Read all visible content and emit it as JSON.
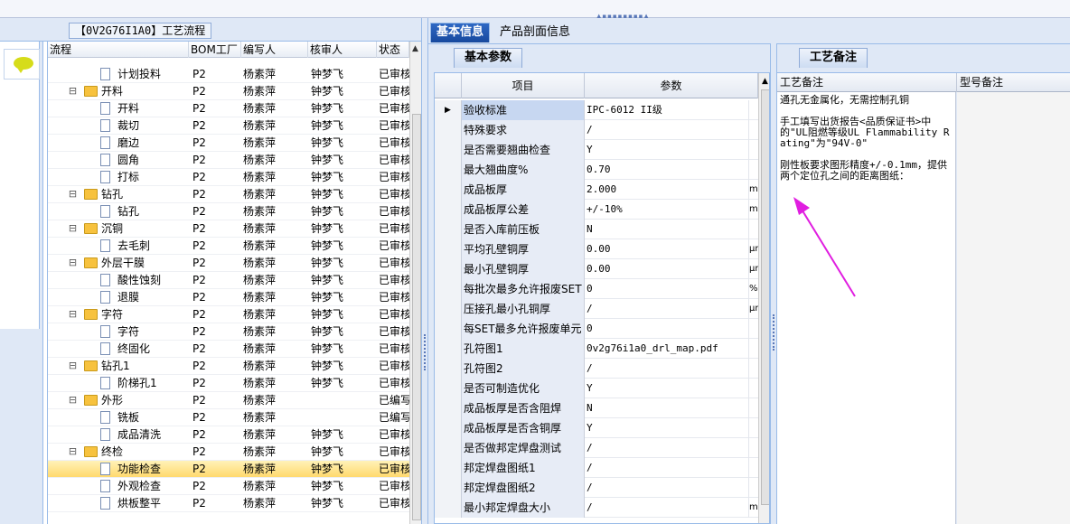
{
  "process_tab_title": "【0V2G76I1A0】工艺流程",
  "tree": {
    "columns": [
      "流程",
      "BOM工厂",
      "编写人",
      "核审人",
      "状态"
    ],
    "rows": [
      {
        "level": 1,
        "type": "doc",
        "name": "计划投料",
        "bom": "P2",
        "writer": "杨素萍",
        "reviewer": "钟梦飞",
        "status": "已审核"
      },
      {
        "level": 0,
        "type": "folder",
        "name": "开料",
        "bom": "P2",
        "writer": "杨素萍",
        "reviewer": "钟梦飞",
        "status": "已审核"
      },
      {
        "level": 1,
        "type": "doc",
        "name": "开料",
        "bom": "P2",
        "writer": "杨素萍",
        "reviewer": "钟梦飞",
        "status": "已审核"
      },
      {
        "level": 1,
        "type": "doc",
        "name": "裁切",
        "bom": "P2",
        "writer": "杨素萍",
        "reviewer": "钟梦飞",
        "status": "已审核"
      },
      {
        "level": 1,
        "type": "doc",
        "name": "磨边",
        "bom": "P2",
        "writer": "杨素萍",
        "reviewer": "钟梦飞",
        "status": "已审核"
      },
      {
        "level": 1,
        "type": "doc",
        "name": "圆角",
        "bom": "P2",
        "writer": "杨素萍",
        "reviewer": "钟梦飞",
        "status": "已审核"
      },
      {
        "level": 1,
        "type": "doc",
        "name": "打标",
        "bom": "P2",
        "writer": "杨素萍",
        "reviewer": "钟梦飞",
        "status": "已审核"
      },
      {
        "level": 0,
        "type": "folder",
        "name": "钻孔",
        "bom": "P2",
        "writer": "杨素萍",
        "reviewer": "钟梦飞",
        "status": "已审核"
      },
      {
        "level": 1,
        "type": "doc",
        "name": "钻孔",
        "bom": "P2",
        "writer": "杨素萍",
        "reviewer": "钟梦飞",
        "status": "已审核"
      },
      {
        "level": 0,
        "type": "folder",
        "name": "沉铜",
        "bom": "P2",
        "writer": "杨素萍",
        "reviewer": "钟梦飞",
        "status": "已审核"
      },
      {
        "level": 1,
        "type": "doc",
        "name": "去毛刺",
        "bom": "P2",
        "writer": "杨素萍",
        "reviewer": "钟梦飞",
        "status": "已审核"
      },
      {
        "level": 0,
        "type": "folder",
        "name": "外层干膜",
        "bom": "P2",
        "writer": "杨素萍",
        "reviewer": "钟梦飞",
        "status": "已审核"
      },
      {
        "level": 1,
        "type": "doc",
        "name": "酸性蚀刻",
        "bom": "P2",
        "writer": "杨素萍",
        "reviewer": "钟梦飞",
        "status": "已审核"
      },
      {
        "level": 1,
        "type": "doc",
        "name": "退膜",
        "bom": "P2",
        "writer": "杨素萍",
        "reviewer": "钟梦飞",
        "status": "已审核"
      },
      {
        "level": 0,
        "type": "folder",
        "name": "字符",
        "bom": "P2",
        "writer": "杨素萍",
        "reviewer": "钟梦飞",
        "status": "已审核"
      },
      {
        "level": 1,
        "type": "doc",
        "name": "字符",
        "bom": "P2",
        "writer": "杨素萍",
        "reviewer": "钟梦飞",
        "status": "已审核"
      },
      {
        "level": 1,
        "type": "doc",
        "name": "终固化",
        "bom": "P2",
        "writer": "杨素萍",
        "reviewer": "钟梦飞",
        "status": "已审核"
      },
      {
        "level": 0,
        "type": "folder",
        "name": "钻孔1",
        "bom": "P2",
        "writer": "杨素萍",
        "reviewer": "钟梦飞",
        "status": "已审核"
      },
      {
        "level": 1,
        "type": "doc",
        "name": "阶梯孔1",
        "bom": "P2",
        "writer": "杨素萍",
        "reviewer": "钟梦飞",
        "status": "已审核"
      },
      {
        "level": 0,
        "type": "folder",
        "name": "外形",
        "bom": "P2",
        "writer": "杨素萍",
        "reviewer": "",
        "status": "已编写"
      },
      {
        "level": 1,
        "type": "doc",
        "name": "铣板",
        "bom": "P2",
        "writer": "杨素萍",
        "reviewer": "",
        "status": "已编写"
      },
      {
        "level": 1,
        "type": "doc",
        "name": "成品清洗",
        "bom": "P2",
        "writer": "杨素萍",
        "reviewer": "钟梦飞",
        "status": "已审核"
      },
      {
        "level": 0,
        "type": "folder",
        "name": "终检",
        "bom": "P2",
        "writer": "杨素萍",
        "reviewer": "钟梦飞",
        "status": "已审核"
      },
      {
        "level": 1,
        "type": "doc",
        "name": "功能检查",
        "bom": "P2",
        "writer": "杨素萍",
        "reviewer": "钟梦飞",
        "status": "已审核",
        "selected": true
      },
      {
        "level": 1,
        "type": "doc",
        "name": "外观检查",
        "bom": "P2",
        "writer": "杨素萍",
        "reviewer": "钟梦飞",
        "status": "已审核"
      },
      {
        "level": 1,
        "type": "doc",
        "name": "烘板整平",
        "bom": "P2",
        "writer": "杨素萍",
        "reviewer": "钟梦飞",
        "status": "已审核"
      }
    ]
  },
  "main_tabs": [
    "基本信息",
    "产品剖面信息"
  ],
  "sub_tab": "基本参数",
  "params": {
    "columns": [
      "项目",
      "参数"
    ],
    "rows": [
      {
        "key": "验收标准",
        "value": "IPC-6012 II级",
        "unit": "",
        "current": true
      },
      {
        "key": "特殊要求",
        "value": "/",
        "unit": ""
      },
      {
        "key": "是否需要翘曲检查",
        "value": "Y",
        "unit": ""
      },
      {
        "key": "最大翘曲度%",
        "value": "0.70",
        "unit": ""
      },
      {
        "key": "成品板厚",
        "value": "2.000",
        "unit": "mm"
      },
      {
        "key": "成品板厚公差",
        "value": "+/-10%",
        "unit": "mm"
      },
      {
        "key": "是否入库前压板",
        "value": "N",
        "unit": ""
      },
      {
        "key": "平均孔壁铜厚",
        "value": "0.00",
        "unit": "μm"
      },
      {
        "key": "最小孔壁铜厚",
        "value": "0.00",
        "unit": "μm"
      },
      {
        "key": "每批次最多允许报废SET",
        "value": "0",
        "unit": "%"
      },
      {
        "key": "压接孔最小孔铜厚",
        "value": "/",
        "unit": "μm"
      },
      {
        "key": "每SET最多允许报废单元",
        "value": "0",
        "unit": ""
      },
      {
        "key": "孔符图1",
        "value": "0v2g76i1a0_drl_map.pdf",
        "unit": ""
      },
      {
        "key": "孔符图2",
        "value": "/",
        "unit": ""
      },
      {
        "key": "是否可制造优化",
        "value": "Y",
        "unit": ""
      },
      {
        "key": "成品板厚是否含阻焊",
        "value": "N",
        "unit": ""
      },
      {
        "key": "成品板厚是否含铜厚",
        "value": "Y",
        "unit": ""
      },
      {
        "key": "是否做邦定焊盘测试",
        "value": "/",
        "unit": ""
      },
      {
        "key": "邦定焊盘图纸1",
        "value": "/",
        "unit": ""
      },
      {
        "key": "邦定焊盘图纸2",
        "value": "/",
        "unit": ""
      },
      {
        "key": "最小邦定焊盘大小",
        "value": "/",
        "unit": "mm"
      }
    ]
  },
  "right_tab": "工艺备注",
  "notes": {
    "columns": [
      "工艺备注",
      "型号备注"
    ],
    "text": "通孔无金属化，无需控制孔铜\n\n手工填写出货报告<品质保证书>中的\"UL阻燃等级UL Flammability Rating\"为\"94V-0\"\n\n刚性板要求图形精度+/-0.1mm，提供两个定位孔之间的距离图纸：",
    "annotation_color": "#e01ee0"
  }
}
